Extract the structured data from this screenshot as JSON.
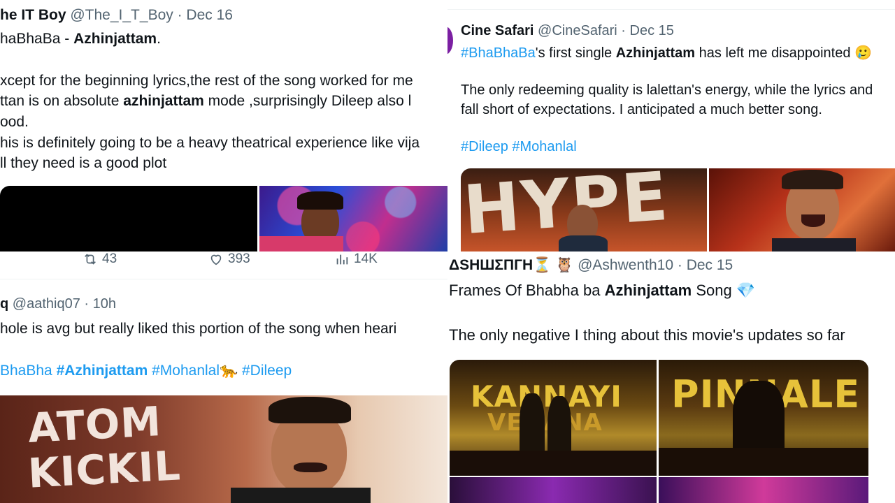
{
  "tweet1": {
    "name": "he IT Boy",
    "handle": "@The_I_T_Boy",
    "date": "Dec 16",
    "lines": {
      "l1a": "haBhaBa - ",
      "l1b": "Azhinjattam",
      "l1c": ".",
      "l2": "xcept for the beginning lyrics,the rest of the song worked for me",
      "l3a": "ttan is on absolute ",
      "l3b": "azhinjattam",
      "l3c": " mode ,surprisingly Dileep also l",
      "l4": "ood.",
      "l5": "his is definitely going to be a heavy theatrical experience like vija",
      "l6": "ll they need is a good plot"
    },
    "metrics": {
      "retweets": "43",
      "likes": "393",
      "views": "14K"
    }
  },
  "tweet2": {
    "name": "Cine Safari",
    "handle": "@CineSafari",
    "date": "Dec 15",
    "lines": {
      "l1a": "#BhaBhaBa",
      "l1b": "'s first single ",
      "l1c": "Azhinjattam",
      "l1d": " has left me disappointed 🥲",
      "l2": "The only redeeming quality is lalettan's energy, while the lyrics and",
      "l3": "fall short of expectations. I anticipated a much better song.",
      "t1": "#Dileep",
      "t2": "#Mohanlal"
    },
    "image_text": "HYPE"
  },
  "tweet3": {
    "name": "q",
    "handle": "@aathiq07",
    "date": "10h",
    "lines": {
      "l1": "hole is avg but really liked this portion of the song when heari",
      "t1": "BhaBha",
      "t2": "#Azhinjattam",
      "t3": "#Mohanlal🐆",
      "t4": "#Dileep"
    },
    "image_text": {
      "a": "ATOM",
      "b": "KICKIL"
    }
  },
  "tweet4": {
    "name": "ΔSHШΣПГH⏳ 🦉",
    "handle": "@Ashwenth10",
    "date": "Dec 15",
    "lines": {
      "l1a": "Frames Of Bhabha ba ",
      "l1b": "Azhinjattam",
      "l1c": " Song 💎",
      "l2": "The only negative I thing about this movie's updates so far"
    },
    "image_text": {
      "a": "KANNAYI",
      "b": "VEDANA",
      "c": "PINNALE"
    }
  },
  "colors": {
    "link": "#1d9bf0",
    "muted": "#536471",
    "text": "#0f1419"
  }
}
